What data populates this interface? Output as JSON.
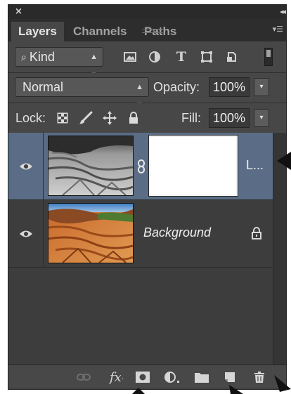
{
  "panel": {
    "close_glyph": "×",
    "collapse_glyph": "◂◂"
  },
  "tabs": [
    {
      "label": "Layers",
      "active": true
    },
    {
      "label": "Channels",
      "active": false
    },
    {
      "label": "Paths",
      "active": false
    }
  ],
  "filter": {
    "kind_label": "Kind",
    "icons": [
      "pixel-layer-filter-icon",
      "adjustment-layer-filter-icon",
      "type-layer-filter-icon",
      "shape-layer-filter-icon",
      "smart-object-filter-icon"
    ]
  },
  "blend": {
    "mode": "Normal",
    "opacity_label": "Opacity:",
    "opacity_value": "100%"
  },
  "lock": {
    "label": "Lock:",
    "fill_label": "Fill:",
    "fill_value": "100%"
  },
  "layers": [
    {
      "name": "L...",
      "selected": true,
      "visible": true,
      "has_mask": true,
      "locked": false
    },
    {
      "name": "Background",
      "selected": false,
      "visible": true,
      "has_mask": false,
      "locked": true
    }
  ],
  "footer": {
    "fx_label": "fx",
    "icons": [
      "link-layers-icon",
      "fx-icon",
      "add-mask-icon",
      "adjustment-layer-icon",
      "new-group-icon",
      "new-layer-icon",
      "delete-icon"
    ]
  },
  "colors": {
    "selected_row": "#5b6d86",
    "panel_bg": "#474747",
    "layers_bg": "#3d3d3d"
  }
}
